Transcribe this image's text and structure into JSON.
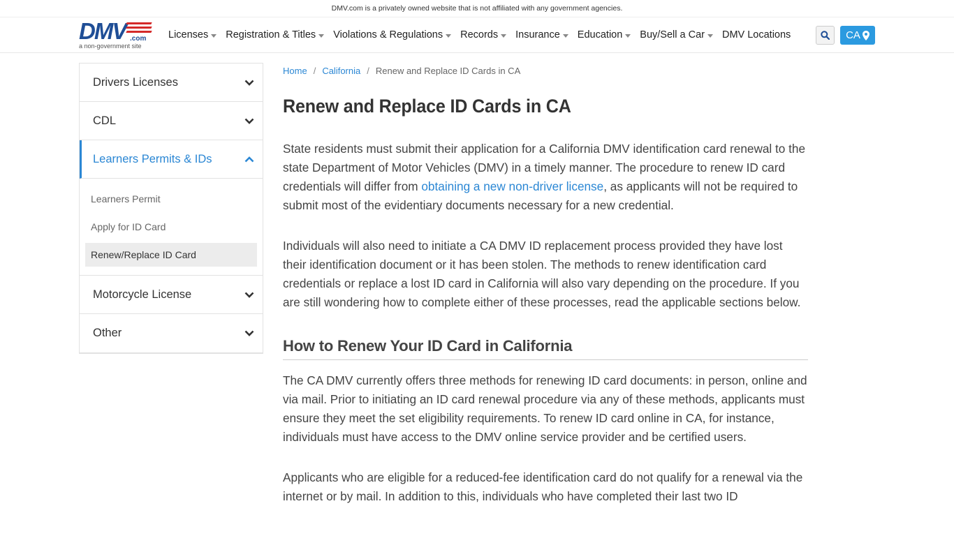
{
  "topbar": {
    "disclaimer": "DMV.com is a privately owned website that is not affiliated with any government agencies."
  },
  "logo": {
    "mark": "DMV",
    "suffix": ".com",
    "tagline": "a non-government site"
  },
  "nav": [
    {
      "label": "Licenses",
      "dropdown": true
    },
    {
      "label": "Registration & Titles",
      "dropdown": true
    },
    {
      "label": "Violations & Regulations",
      "dropdown": true
    },
    {
      "label": "Records",
      "dropdown": true
    },
    {
      "label": "Insurance",
      "dropdown": true
    },
    {
      "label": "Education",
      "dropdown": true
    },
    {
      "label": "Buy/Sell a Car",
      "dropdown": true
    },
    {
      "label": "DMV Locations",
      "dropdown": false
    }
  ],
  "state_button": {
    "label": "CA",
    "icon": "map-marker-icon"
  },
  "search_button": {
    "icon": "search-icon"
  },
  "sidebar": {
    "sections": [
      {
        "label": "Drivers Licenses",
        "expanded": false
      },
      {
        "label": "CDL",
        "expanded": false
      },
      {
        "label": "Learners Permits & IDs",
        "expanded": true
      },
      {
        "label": "Motorcycle License",
        "expanded": false
      },
      {
        "label": "Other",
        "expanded": false
      }
    ],
    "sub_items": [
      "Learners Permit",
      "Apply for ID Card",
      "Renew/Replace ID Card"
    ],
    "current_sub_item": "Renew/Replace ID Card"
  },
  "breadcrumb": {
    "home": "Home",
    "state": "California",
    "current": "Renew and Replace ID Cards in CA",
    "separator": "/"
  },
  "article": {
    "title": "Renew and Replace ID Cards in CA",
    "p1_before": "State residents must submit their application for a California DMV identification card renewal to the state Department of Motor Vehicles (DMV) in a timely manner. The procedure to renew ID card credentials will differ from ",
    "p1_link": "obtaining a new non-driver license",
    "p1_after": ", as applicants will not be required to submit most of the evidentiary documents necessary for a new credential.",
    "p2": "Individuals will also need to initiate a CA DMV ID replacement process provided they have lost their identification document or it has been stolen. The methods to renew identification card credentials or replace a lost ID card in California will also vary depending on the procedure. If you are still wondering how to complete either of these processes, read the applicable sections below.",
    "h2": "How to Renew Your ID Card in California",
    "p3": "The CA DMV currently offers three methods for renewing ID card documents: in person, online and via mail. Prior to initiating an ID card renewal procedure via any of these methods, applicants must ensure they meet the set eligibility requirements. To renew ID card online in CA, for instance, individuals must have access to the DMV online service provider and be certified users.",
    "p4": "Applicants who are eligible for a reduced-fee identification card do not qualify for a renewal via the internet or by mail. In addition to this, individuals who have completed their last two ID"
  },
  "colors": {
    "brand_blue": "#1f4e96",
    "brand_red": "#d42a2a",
    "link": "#2b87d4",
    "state_button": "#2b9ae0"
  }
}
